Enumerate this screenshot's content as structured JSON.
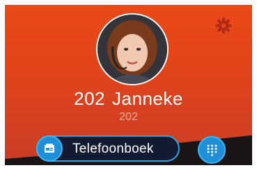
{
  "contact": {
    "extension": "202",
    "name": "Janneke",
    "number": "202"
  },
  "actions": {
    "phonebook_label": "Telefoonboek"
  },
  "icons": {
    "settings": "gear-icon",
    "phonebook": "phonebook-icon",
    "dialpad": "dialpad-icon"
  },
  "colors": {
    "background_top": "#ea4a17",
    "background_bottom": "#c93d24",
    "accent_blue": "#1e8fd8",
    "button_dark": "#131b33",
    "gear": "#b22a18"
  }
}
